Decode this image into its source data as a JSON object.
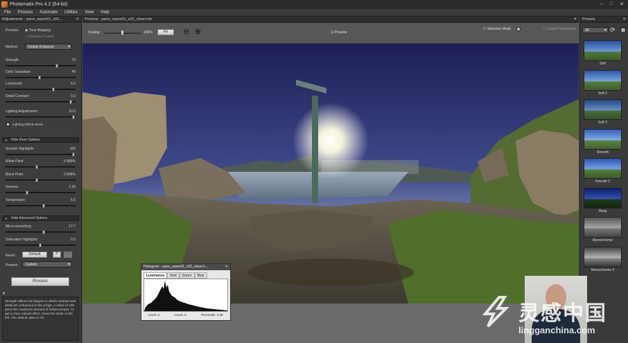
{
  "titlebar": {
    "title": "Photomatix Pro 4.2 (64-bit)",
    "min": "–",
    "max": "□",
    "close": "✕"
  },
  "menu": [
    "File",
    "Process",
    "Automate",
    "Utilities",
    "View",
    "Help"
  ],
  "adjustments": {
    "title": "Adjustments - pano_arpex01_v02...",
    "close": "✕",
    "process_label": "Process:",
    "process_options": [
      "Tone Mapping",
      "Exposure Fusion"
    ],
    "method_label": "Method:",
    "method_value": "Details Enhancer",
    "sliders": [
      {
        "label": "Strength",
        "value": "75",
        "level": 0.75
      },
      {
        "label": "Color Saturation",
        "value": "49",
        "level": 0.49
      },
      {
        "label": "Luminosity",
        "value": "6.0",
        "level": 0.7
      },
      {
        "label": "Detail Contrast",
        "value": "9.3",
        "level": 0.96
      },
      {
        "label": "Lighting Adjustments",
        "value": "10.0",
        "level": 1.0
      }
    ],
    "lighting_effects": "Lighting Effects Mode",
    "hide_more": "Hide More Options",
    "more_sliders": [
      {
        "label": "Smooth Highlights",
        "value": "100",
        "level": 1.0
      },
      {
        "label": "White Point",
        "value": "0.989%",
        "level": 0.45
      },
      {
        "label": "Black Point",
        "value": "0.808%",
        "level": 0.45
      },
      {
        "label": "Gamma",
        "value": "1.20",
        "level": 0.3
      },
      {
        "label": "Temperature",
        "value": "5.5",
        "level": 0.55
      }
    ],
    "hide_advanced": "Hide Advanced Options",
    "adv_sliders": [
      {
        "label": "Micro-smoothing",
        "value": "17.7",
        "level": 0.55
      },
      {
        "label": "Saturation Highlights",
        "value": "0.0",
        "level": 0.5
      }
    ],
    "reset_label": "Reset:",
    "default_btn": "Default",
    "presets_label": "Presets:",
    "presets_value": "Custom",
    "process_btn": "Process",
    "help": "Strength affects the degree to which contrast and detail are enhanced in the image. A value of 100 gives the maximum amount of enhancement. To get a more natural effect, move the slider to the left. The default value is 70."
  },
  "preview": {
    "title": "Preview - pano_arpex01_v02_clean.hdr",
    "close": "✕",
    "scaling_label": "Scaling",
    "zoom": "100%",
    "fit_btn": "Fit",
    "preview_check": "Preview",
    "selection_mode": "Selection Mode",
    "loupe": "Loupe/Comparison"
  },
  "presets": {
    "title": "Presets",
    "close": "✕",
    "filter": "All",
    "items": [
      "Soft",
      "Soft 2",
      "Soft 3",
      "Smooth",
      "Smooth 2",
      "Deep",
      "Monochrome",
      "Monochrome 2"
    ]
  },
  "histogram": {
    "title": "Histogram - pano_arpex01_v02_clean.h...",
    "close": "✕",
    "tabs": [
      "Luminance",
      "Red",
      "Green",
      "Blue"
    ],
    "level": "Level: 0",
    "count": "Count: 0",
    "percentile": "Percentile: 0.00"
  },
  "watermark": {
    "cn": "灵感中国",
    "url": "lingganchina.com"
  }
}
